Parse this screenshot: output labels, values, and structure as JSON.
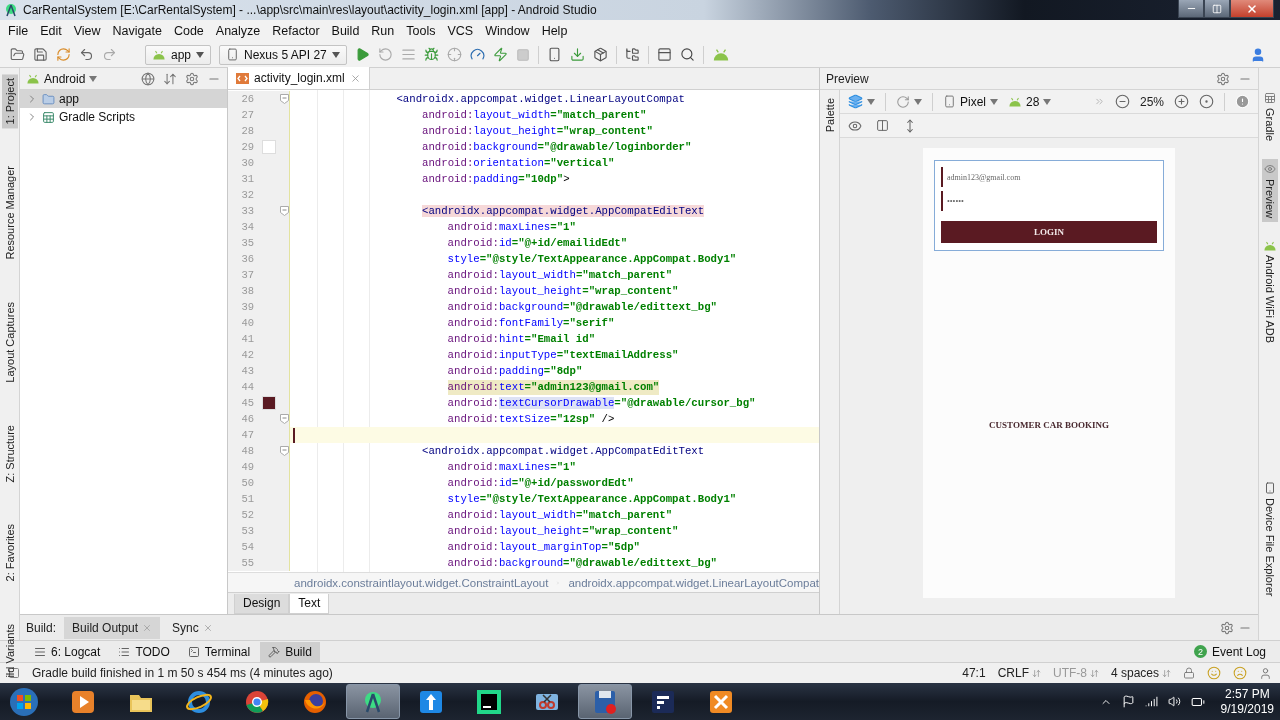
{
  "window": {
    "title": "CarRentalSystem [E:\\CarRentalSystem] - ...\\app\\src\\main\\res\\layout\\activity_login.xml [app] - Android Studio"
  },
  "menu": [
    "File",
    "Edit",
    "View",
    "Navigate",
    "Code",
    "Analyze",
    "Refactor",
    "Build",
    "Run",
    "Tools",
    "VCS",
    "Window",
    "Help"
  ],
  "toolbar": {
    "module": "app",
    "device": "Nexus 5 API 27"
  },
  "left_stripe": [
    {
      "label": "1: Project",
      "selected": true
    },
    {
      "label": "Resource Manager",
      "selected": false
    },
    {
      "label": "Layout Captures",
      "selected": false
    },
    {
      "label": "Z: Structure",
      "selected": false
    },
    {
      "label": "2: Favorites",
      "selected": false
    },
    {
      "label": "ild Variants",
      "selected": false
    }
  ],
  "project": {
    "view": "Android",
    "tree": [
      {
        "label": "app",
        "kind": "module",
        "selected": true,
        "expanded": false
      },
      {
        "label": "Gradle Scripts",
        "kind": "gradle",
        "selected": false,
        "expanded": false
      }
    ]
  },
  "editor": {
    "tabs": [
      {
        "label": "activity_login.xml",
        "selected": true
      }
    ],
    "lines": [
      {
        "number": "26",
        "fold": true,
        "current": false,
        "highlighted": false,
        "tokens": [
          {
            "kind": "tag",
            "text": "<androidx.appcompat.widget.LinearLayoutCompat"
          }
        ],
        "children": [
          {
            "number": "27",
            "fold": false,
            "current": false,
            "highlighted": false,
            "tokens": [
              {
                "kind": "ns",
                "text": "android:"
              },
              {
                "kind": "attr",
                "text": "layout_width"
              },
              {
                "kind": "val",
                "text": "=\"match_parent\""
              }
            ]
          },
          {
            "number": "28",
            "fold": false,
            "current": false,
            "highlighted": false,
            "tokens": [
              {
                "kind": "ns",
                "text": "android:"
              },
              {
                "kind": "attr",
                "text": "layout_height"
              },
              {
                "kind": "val",
                "text": "=\"wrap_content\""
              }
            ]
          },
          {
            "number": "29",
            "fold": false,
            "current": false,
            "highlighted": false,
            "color": "#ffffff",
            "tokens": [
              {
                "kind": "ns",
                "text": "android:"
              },
              {
                "kind": "attr",
                "text": "background"
              },
              {
                "kind": "val",
                "text": "=\"@drawable/loginborder\""
              }
            ]
          },
          {
            "number": "30",
            "fold": false,
            "current": false,
            "highlighted": false,
            "tokens": [
              {
                "kind": "ns",
                "text": "android:"
              },
              {
                "kind": "attr",
                "text": "orientation"
              },
              {
                "kind": "val",
                "text": "=\"vertical\""
              }
            ]
          },
          {
            "number": "31",
            "fold": false,
            "current": false,
            "highlighted": false,
            "tokens": [
              {
                "kind": "ns",
                "text": "android:"
              },
              {
                "kind": "attr",
                "text": "padding"
              },
              {
                "kind": "val",
                "text": "=\"10dp\""
              },
              {
                "kind": "punct",
                "text": ">"
              }
            ]
          },
          {
            "number": "32",
            "fold": false,
            "current": false
          },
          {
            "number": "33",
            "fold": true,
            "current": false,
            "highlighted": false,
            "tokens": [
              {
                "kind": "tagm",
                "text": "<androidx.appcompat.widget.AppCompatEditText"
              }
            ],
            "children": [
              {
                "number": "34",
                "fold": false,
                "current": false,
                "highlighted": false,
                "tokens": [
                  {
                    "kind": "ns",
                    "text": "android:"
                  },
                  {
                    "kind": "attr",
                    "text": "maxLines"
                  },
                  {
                    "kind": "val",
                    "text": "=\"1\""
                  }
                ]
              },
              {
                "number": "35",
                "fold": false,
                "current": false,
                "highlighted": false,
                "tokens": [
                  {
                    "kind": "ns",
                    "text": "android:"
                  },
                  {
                    "kind": "attr",
                    "text": "id"
                  },
                  {
                    "kind": "val",
                    "text": "=\"@+id/emailidEdt\""
                  }
                ]
              },
              {
                "number": "36",
                "fold": false,
                "current": false,
                "highlighted": false,
                "tokens": [
                  {
                    "kind": "attr",
                    "text": "style"
                  },
                  {
                    "kind": "val",
                    "text": "=\"@style/TextAppearance.AppCompat.Body1\""
                  }
                ]
              },
              {
                "number": "37",
                "fold": false,
                "current": false,
                "highlighted": false,
                "tokens": [
                  {
                    "kind": "ns",
                    "text": "android:"
                  },
                  {
                    "kind": "attr",
                    "text": "layout_width"
                  },
                  {
                    "kind": "val",
                    "text": "=\"match_parent\""
                  }
                ]
              },
              {
                "number": "38",
                "fold": false,
                "current": false,
                "highlighted": false,
                "tokens": [
                  {
                    "kind": "ns",
                    "text": "android:"
                  },
                  {
                    "kind": "attr",
                    "text": "layout_height"
                  },
                  {
                    "kind": "val",
                    "text": "=\"wrap_content\""
                  }
                ]
              },
              {
                "number": "39",
                "fold": false,
                "current": false,
                "highlighted": false,
                "tokens": [
                  {
                    "kind": "ns",
                    "text": "android:"
                  },
                  {
                    "kind": "attr",
                    "text": "background"
                  },
                  {
                    "kind": "val",
                    "text": "=\"@drawable/edittext_bg\""
                  }
                ]
              },
              {
                "number": "40",
                "fold": false,
                "current": false,
                "highlighted": false,
                "tokens": [
                  {
                    "kind": "ns",
                    "text": "android:"
                  },
                  {
                    "kind": "attr",
                    "text": "fontFamily"
                  },
                  {
                    "kind": "val",
                    "text": "=\"serif\""
                  }
                ]
              },
              {
                "number": "41",
                "fold": false,
                "current": false,
                "highlighted": false,
                "tokens": [
                  {
                    "kind": "ns",
                    "text": "android:"
                  },
                  {
                    "kind": "attr",
                    "text": "hint"
                  },
                  {
                    "kind": "val",
                    "text": "=\"Email id\""
                  }
                ]
              },
              {
                "number": "42",
                "fold": false,
                "current": false,
                "highlighted": false,
                "tokens": [
                  {
                    "kind": "ns",
                    "text": "android:"
                  },
                  {
                    "kind": "attr",
                    "text": "inputType"
                  },
                  {
                    "kind": "val",
                    "text": "=\"textEmailAddress\""
                  }
                ]
              },
              {
                "number": "43",
                "fold": false,
                "current": false,
                "highlighted": false,
                "tokens": [
                  {
                    "kind": "ns",
                    "text": "android:"
                  },
                  {
                    "kind": "attr",
                    "text": "padding"
                  },
                  {
                    "kind": "val",
                    "text": "=\"8dp\""
                  }
                ]
              },
              {
                "number": "44",
                "fold": false,
                "current": false,
                "highlighted": true,
                "tokens": [
                  {
                    "kind": "ns",
                    "text": "android:"
                  },
                  {
                    "kind": "attr",
                    "text": "text"
                  },
                  {
                    "kind": "val",
                    "text": "=\"admin123@gmail.com\""
                  }
                ]
              },
              {
                "number": "45",
                "fold": false,
                "current": false,
                "highlighted": false,
                "color": "#5a1a22",
                "tokens": [
                  {
                    "kind": "ns",
                    "text": "android:"
                  },
                  {
                    "kind": "attrm",
                    "text": "textCursorDrawable"
                  },
                  {
                    "kind": "val",
                    "text": "=\"@drawable/cursor_bg\""
                  }
                ]
              },
              {
                "number": "46",
                "fold": true,
                "current": false,
                "highlighted": false,
                "tokens": [
                  {
                    "kind": "ns",
                    "text": "android:"
                  },
                  {
                    "kind": "attr",
                    "text": "textSize"
                  },
                  {
                    "kind": "val",
                    "text": "=\"12sp\""
                  },
                  {
                    "kind": "punct",
                    "text": " />"
                  }
                ]
              }
            ]
          },
          {
            "number": "47",
            "fold": false,
            "current": true
          },
          {
            "number": "48",
            "fold": true,
            "current": false,
            "highlighted": false,
            "tokens": [
              {
                "kind": "tag",
                "text": "<androidx.appcompat.widget.AppCompatEditText"
              }
            ],
            "children": [
              {
                "number": "49",
                "fold": false,
                "current": false,
                "highlighted": false,
                "tokens": [
                  {
                    "kind": "ns",
                    "text": "android:"
                  },
                  {
                    "kind": "attr",
                    "text": "maxLines"
                  },
                  {
                    "kind": "val",
                    "text": "=\"1\""
                  }
                ]
              },
              {
                "number": "50",
                "fold": false,
                "current": false,
                "highlighted": false,
                "tokens": [
                  {
                    "kind": "ns",
                    "text": "android:"
                  },
                  {
                    "kind": "attr",
                    "text": "id"
                  },
                  {
                    "kind": "val",
                    "text": "=\"@+id/passwordEdt\""
                  }
                ]
              },
              {
                "number": "51",
                "fold": false,
                "current": false,
                "highlighted": false,
                "tokens": [
                  {
                    "kind": "attr",
                    "text": "style"
                  },
                  {
                    "kind": "val",
                    "text": "=\"@style/TextAppearance.AppCompat.Body1\""
                  }
                ]
              },
              {
                "number": "52",
                "fold": false,
                "current": false,
                "highlighted": false,
                "tokens": [
                  {
                    "kind": "ns",
                    "text": "android:"
                  },
                  {
                    "kind": "attr",
                    "text": "layout_width"
                  },
                  {
                    "kind": "val",
                    "text": "=\"match_parent\""
                  }
                ]
              },
              {
                "number": "53",
                "fold": false,
                "current": false,
                "highlighted": false,
                "tokens": [
                  {
                    "kind": "ns",
                    "text": "android:"
                  },
                  {
                    "kind": "attr",
                    "text": "layout_height"
                  },
                  {
                    "kind": "val",
                    "text": "=\"wrap_content\""
                  }
                ]
              },
              {
                "number": "54",
                "fold": false,
                "current": false,
                "highlighted": false,
                "tokens": [
                  {
                    "kind": "ns",
                    "text": "android:"
                  },
                  {
                    "kind": "attr",
                    "text": "layout_marginTop"
                  },
                  {
                    "kind": "val",
                    "text": "=\"5dp\""
                  }
                ]
              },
              {
                "number": "55",
                "fold": false,
                "current": false,
                "highlighted": false,
                "tokens": [
                  {
                    "kind": "ns",
                    "text": "android:"
                  },
                  {
                    "kind": "attr",
                    "text": "background"
                  },
                  {
                    "kind": "val",
                    "text": "=\"@drawable/edittext_bg\""
                  }
                ]
              }
            ]
          }
        ]
      }
    ],
    "breadcrumb": [
      "androidx.constraintlayout.widget.ConstraintLayout",
      "androidx.appcompat.widget.LinearLayoutCompat"
    ],
    "mode_tabs": [
      {
        "label": "Design",
        "selected": false
      },
      {
        "label": "Text",
        "selected": true
      }
    ]
  },
  "preview": {
    "title": "Preview",
    "palette": "Palette",
    "device": "Pixel",
    "api": "28",
    "zoom": "25%",
    "screen": {
      "email": "admin123@gmail.com",
      "password": "••••••",
      "button": "LOGIN",
      "caption": "CUSTOMER CAR BOOKING"
    }
  },
  "right_stripe": [
    {
      "label": "Gradle",
      "kind": "gradle",
      "selected": false
    },
    {
      "label": "Preview",
      "kind": "preview",
      "selected": true
    },
    {
      "label": "Android WiFi ADB",
      "kind": "adb",
      "selected": false
    },
    {
      "label": "Device File Explorer",
      "kind": "device",
      "selected": false
    }
  ],
  "build_bar": {
    "label": "Build:",
    "tabs": [
      {
        "label": "Build Output",
        "selected": true
      },
      {
        "label": "Sync",
        "selected": false
      }
    ]
  },
  "tool_windows": [
    {
      "label": "6: Logcat",
      "kind": "logcat",
      "selected": false
    },
    {
      "label": "TODO",
      "kind": "todo",
      "selected": false
    },
    {
      "label": "Terminal",
      "kind": "terminal",
      "selected": false
    },
    {
      "label": "Build",
      "kind": "build",
      "selected": true
    }
  ],
  "event_log": {
    "label": "Event Log",
    "badge": "2"
  },
  "status_bar": {
    "message": "Gradle build finished in 1 m 50 s 454 ms (4 minutes ago)",
    "items": [
      {
        "label": "47:1",
        "kind": "text",
        "disabled": false
      },
      {
        "label": "CRLF",
        "kind": "select",
        "disabled": false
      },
      {
        "label": "UTF-8",
        "kind": "select",
        "disabled": true
      },
      {
        "label": "4 spaces",
        "kind": "select",
        "disabled": false
      }
    ]
  },
  "taskbar": {
    "apps": [
      {
        "kind": "media",
        "selected": false
      },
      {
        "kind": "folder",
        "selected": false
      },
      {
        "kind": "ie",
        "selected": false
      },
      {
        "kind": "chrome",
        "selected": false
      },
      {
        "kind": "firefox",
        "selected": false
      },
      {
        "kind": "studio",
        "selected": true
      },
      {
        "kind": "transfer",
        "selected": false
      },
      {
        "kind": "pycharm",
        "selected": false
      },
      {
        "kind": "snip",
        "selected": false
      },
      {
        "kind": "recorder",
        "selected": true
      },
      {
        "kind": "flow",
        "selected": false
      },
      {
        "kind": "xampp",
        "selected": false
      }
    ],
    "time": "2:57 PM",
    "date": "9/19/2019"
  }
}
